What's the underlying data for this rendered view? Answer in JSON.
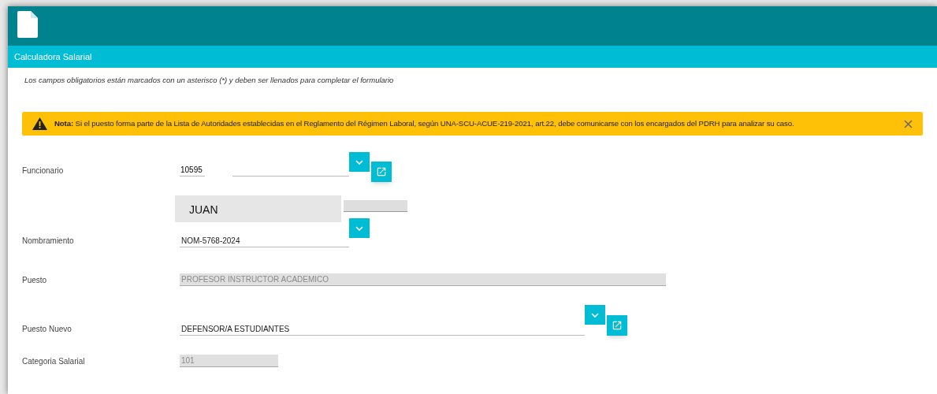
{
  "header": {
    "title": "Calculadora Salarial"
  },
  "instructions": "Los campos obligatorios están marcados con un asterisco (*) y deben ser llenados para completar el formulario",
  "alert": {
    "label": "Nota:",
    "message": "Si el puesto forma parte de la Lista de Autoridades establecidas en el Reglamento del Régimen Laboral, según UNA-SCU-ACUE-219-2021, art.22, debe comunicarse con los encargados del PDRH para analizar su caso."
  },
  "funcionario": {
    "label": "Funcionario",
    "code": "10595",
    "name": "JUAN"
  },
  "nombramiento": {
    "label": "Nombramiento",
    "value": "NOM-5768-2024",
    "disabled": false
  },
  "puesto": {
    "label": "Puesto",
    "value": "PROFESOR INSTRUCTOR ACADEMICO",
    "disabled": true
  },
  "puesto_nuevo": {
    "label": "Puesto Nuevo",
    "value": "DEFENSOR/A ESTUDIANTES",
    "disabled": false
  },
  "categoria": {
    "label": "Categoria Salarial",
    "value": "101",
    "disabled": true
  }
}
